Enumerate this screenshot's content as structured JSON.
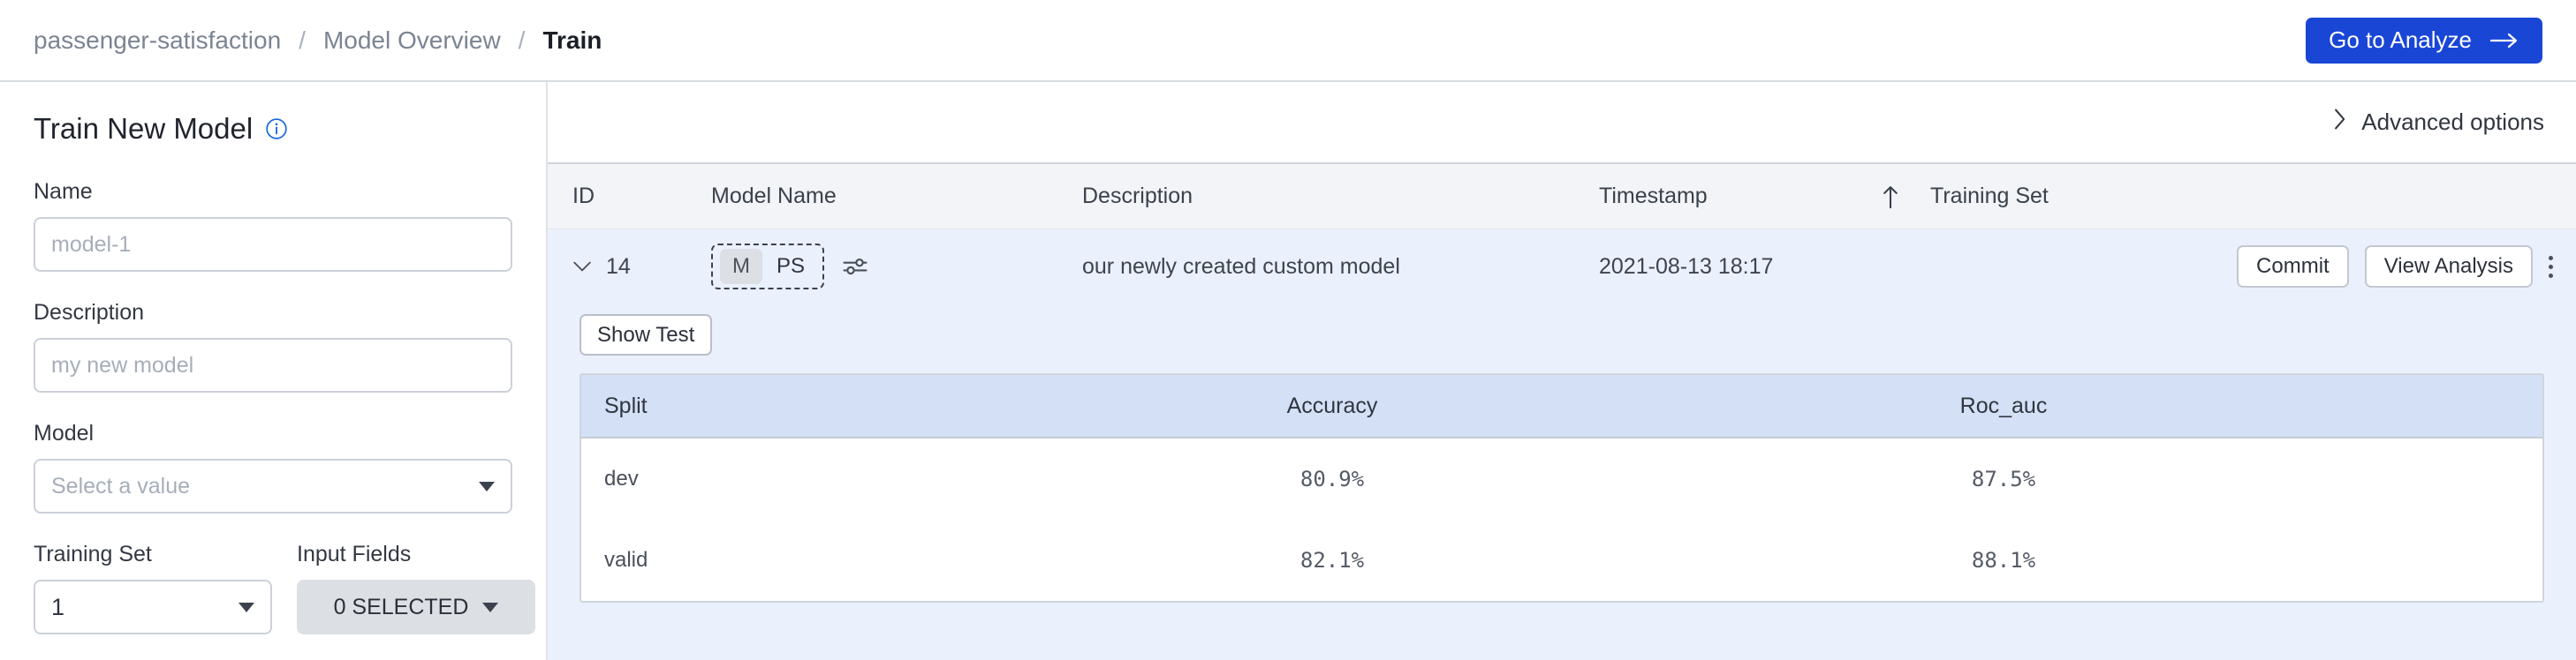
{
  "breadcrumb": {
    "items": [
      "passenger-satisfaction",
      "Model Overview",
      "Train"
    ],
    "separator": "/"
  },
  "topbar": {
    "analyze_button": "Go to Analyze",
    "analyze_arrow": "arrow-right-icon"
  },
  "sidepanel": {
    "title": "Train New Model",
    "info_icon": "info-icon",
    "name": {
      "label": "Name",
      "value": "",
      "placeholder": "model-1"
    },
    "description": {
      "label": "Description",
      "value": "",
      "placeholder": "my new model"
    },
    "model": {
      "label": "Model",
      "value": "Select a value"
    },
    "training_set": {
      "label": "Training Set",
      "value": "1"
    },
    "input_fields": {
      "label": "Input Fields",
      "value": "0 SELECTED"
    }
  },
  "main": {
    "advanced_options": "Advanced options",
    "advanced_chevron": "chevron-right-icon",
    "table": {
      "columns": [
        "ID",
        "Model Name",
        "Description",
        "Timestamp",
        "Training Set"
      ],
      "sort_indicator": "arrow-up-icon",
      "row": {
        "expand_icon": "chevron-down-icon",
        "id": "14",
        "model_tags": [
          "M",
          "PS"
        ],
        "settings_icon": "sliders-icon",
        "description": "our newly created custom model",
        "timestamp": "2021-08-13 18:17",
        "training_set": "",
        "commit_button": "Commit",
        "view_analysis_button": "View Analysis",
        "more_menu": "kebab-menu-icon"
      }
    },
    "detail": {
      "show_test_button": "Show Test",
      "metrics": {
        "columns": [
          "Split",
          "Accuracy",
          "Roc_auc"
        ],
        "rows": [
          {
            "split": "dev",
            "accuracy": "80.9%",
            "roc_auc": "87.5%"
          },
          {
            "split": "valid",
            "accuracy": "82.1%",
            "roc_auc": "88.1%"
          }
        ]
      }
    }
  },
  "colors": {
    "accent": "#1a46d6",
    "row_highlight": "#eaf1fd",
    "header_bg": "#f2f4f8",
    "metrics_header_bg": "#d4e0f6"
  }
}
